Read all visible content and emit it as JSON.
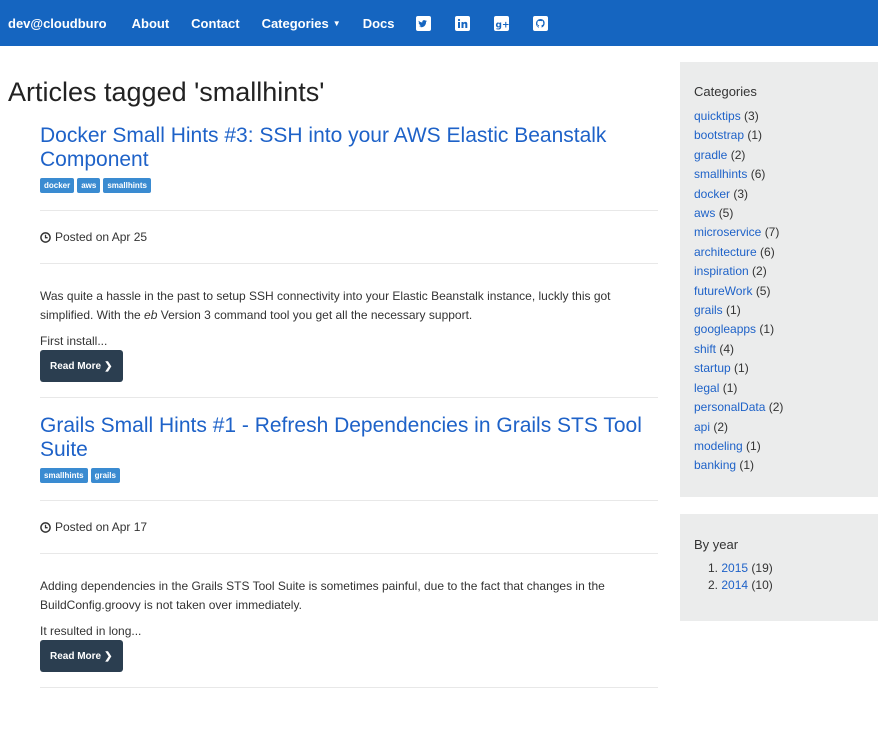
{
  "navbar": {
    "brand": "dev@cloudburo",
    "links": [
      "About",
      "Contact",
      "Categories",
      "Docs"
    ],
    "social_icons": [
      "twitter-icon",
      "linkedin-icon",
      "google-plus-icon",
      "github-icon"
    ],
    "color": "#1565c0"
  },
  "page_title": "Articles tagged 'smallhints'",
  "posts": [
    {
      "title": "Docker Small Hints #3: SSH into your AWS Elastic Beanstalk Component",
      "tags": [
        "docker",
        "aws",
        "smallhints"
      ],
      "posted": "Posted on Apr 25",
      "excerpt_parts": [
        "Was quite a hassle in the past to setup SSH connectivity into your Elastic Beanstalk instance, luckly this got simplified. With the ",
        "eb",
        " Version 3 command tool you get all the necessary support."
      ],
      "more": "First install...",
      "button": "Read More"
    },
    {
      "title": "Grails Small Hints #1 - Refresh Dependencies in Grails STS Tool Suite",
      "tags": [
        "smallhints",
        "grails"
      ],
      "posted": "Posted on Apr 17",
      "excerpt": "Adding dependencies in the Grails STS Tool Suite is sometimes painful, due to the fact that changes in the BuildConfig.groovy is not taken over immediately.",
      "more": "It resulted in long...",
      "button": "Read More"
    }
  ],
  "sidebar": {
    "categories_title": "Categories",
    "categories": [
      {
        "name": "quicktips",
        "count": "(3)"
      },
      {
        "name": "bootstrap",
        "count": "(1)"
      },
      {
        "name": "gradle",
        "count": "(2)"
      },
      {
        "name": "smallhints",
        "count": "(6)"
      },
      {
        "name": "docker",
        "count": "(3)"
      },
      {
        "name": "aws",
        "count": "(5)"
      },
      {
        "name": "microservice",
        "count": "(7)"
      },
      {
        "name": "architecture",
        "count": "(6)"
      },
      {
        "name": "inspiration",
        "count": "(2)"
      },
      {
        "name": "futureWork",
        "count": "(5)"
      },
      {
        "name": "grails",
        "count": "(1)"
      },
      {
        "name": "googleapps",
        "count": "(1)"
      },
      {
        "name": "shift",
        "count": "(4)"
      },
      {
        "name": "startup",
        "count": "(1)"
      },
      {
        "name": "legal",
        "count": "(1)"
      },
      {
        "name": "personalData",
        "count": "(2)"
      },
      {
        "name": "api",
        "count": "(2)"
      },
      {
        "name": "modeling",
        "count": "(1)"
      },
      {
        "name": "banking",
        "count": "(1)"
      }
    ],
    "years_title": "By year",
    "years": [
      {
        "num": "1.",
        "year": "2015",
        "count": "(19)"
      },
      {
        "num": "2.",
        "year": "2014",
        "count": "(10)"
      }
    ]
  }
}
